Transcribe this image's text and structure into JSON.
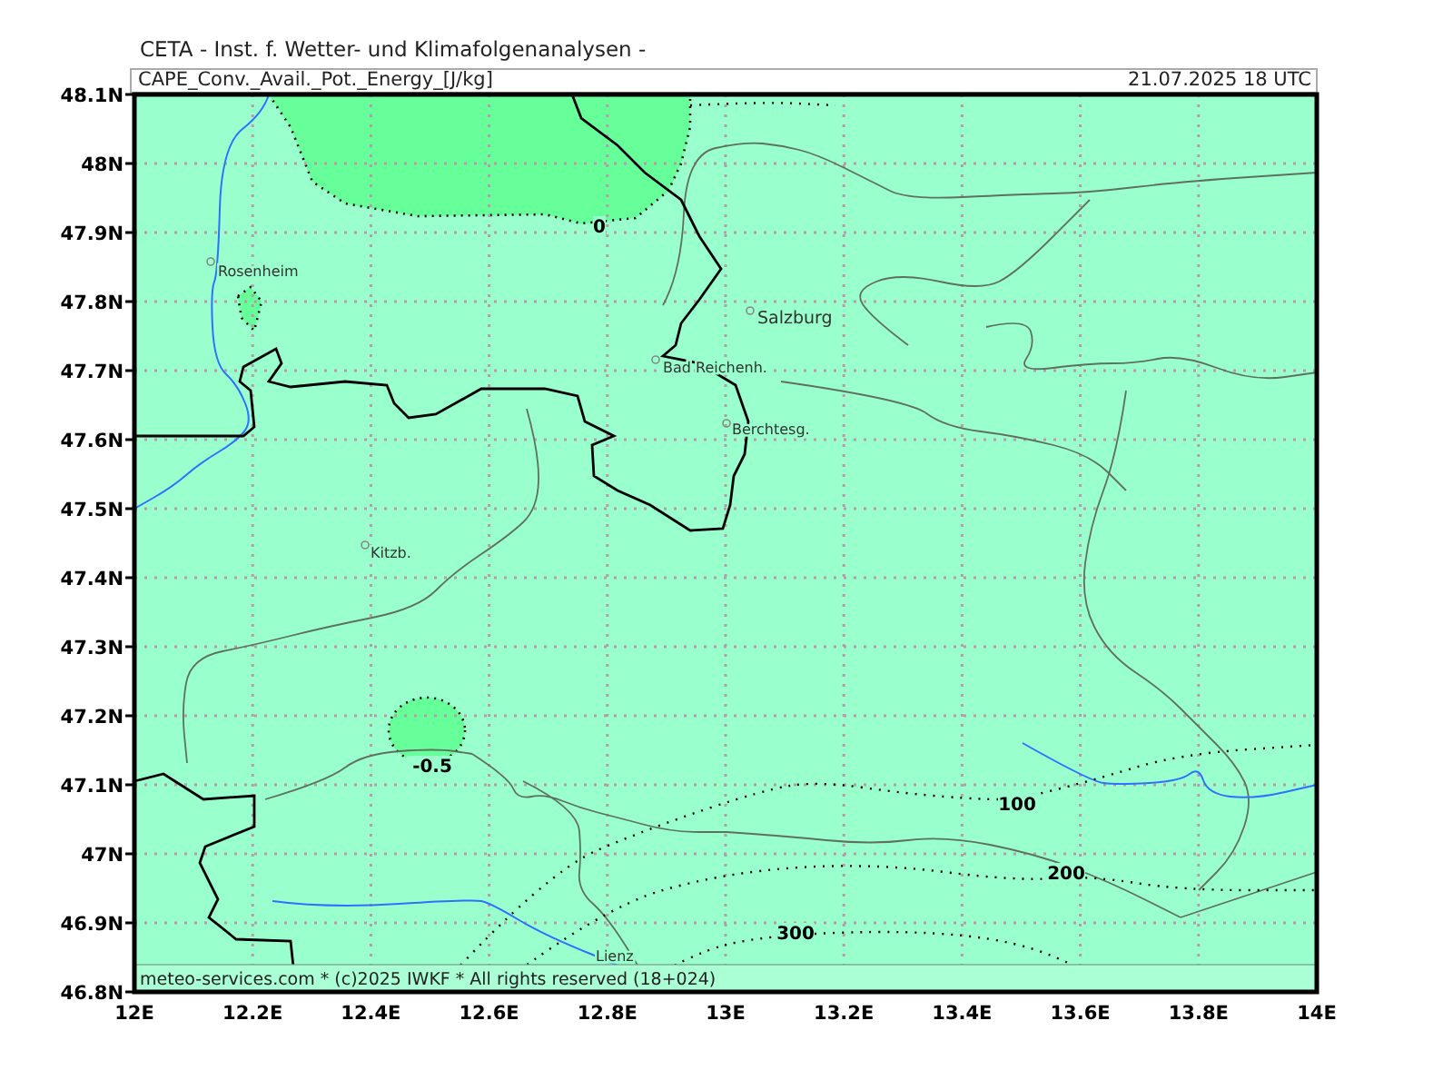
{
  "header": {
    "institute": "CETA - Inst. f. Wetter- und Klimafolgenanalysen -",
    "field": "CAPE_Conv._Avail._Pot._Energy_[J/kg]",
    "valid_time": "21.07.2025 18 UTC"
  },
  "map": {
    "lat_labels": [
      "48.1N",
      "48N",
      "47.9N",
      "47.8N",
      "47.7N",
      "47.6N",
      "47.5N",
      "47.4N",
      "47.3N",
      "47.2N",
      "47.1N",
      "47N",
      "46.9N",
      "46.8N"
    ],
    "lon_labels": [
      "12E",
      "12.2E",
      "12.4E",
      "12.6E",
      "12.8E",
      "13E",
      "13.2E",
      "13.4E",
      "13.6E",
      "13.8E",
      "14E"
    ],
    "places": [
      {
        "name": "Rosenheim"
      },
      {
        "name": "Salzburg"
      },
      {
        "name": "Bad Reichenh."
      },
      {
        "name": "Berchtesg."
      },
      {
        "name": "Kitzb."
      },
      {
        "name": "Lienz"
      }
    ],
    "contour_labels": [
      "0",
      "-0.5",
      "100",
      "200",
      "300"
    ],
    "footer": "meteo-services.com * (c)2025 IWKF * All rights reserved (18+024)"
  }
}
